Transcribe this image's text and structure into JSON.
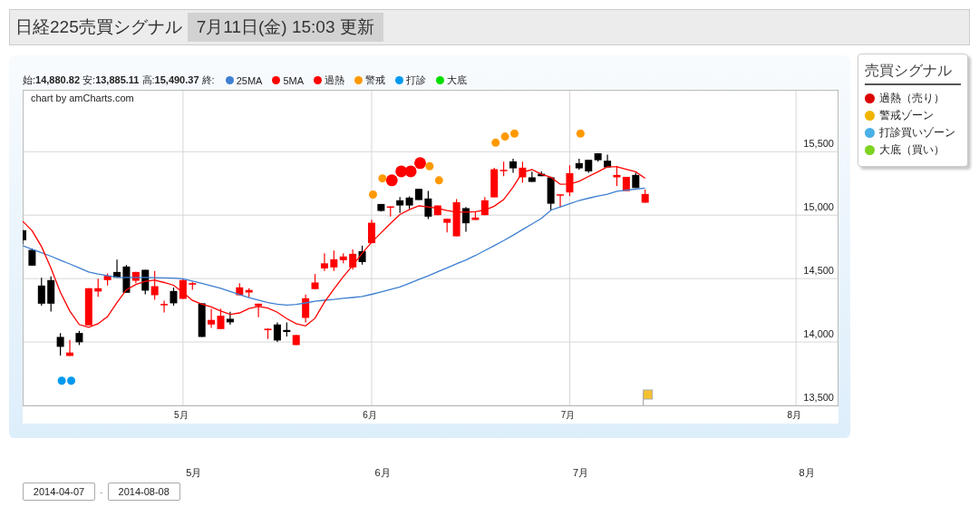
{
  "header": {
    "title": "日経225売買シグナル",
    "updated": "7月11日(金) 15:03 更新"
  },
  "chart": {
    "summary": "始:**14,880.82** 安:**13,885.11** 高:**15,490.37** 終:",
    "credit": "chart by amCharts.com",
    "chart_data": {
      "type": "candlestick",
      "ylim": [
        13500,
        15988
      ],
      "categories": [
        null,
        null,
        null,
        null,
        null,
        null,
        null,
        null,
        null,
        null,
        null,
        null,
        null,
        null,
        null,
        null,
        null,
        "5月",
        null,
        null,
        null,
        null,
        null,
        null,
        null,
        null,
        null,
        null,
        null,
        null,
        null,
        null,
        null,
        null,
        null,
        null,
        null,
        "6月",
        null,
        null,
        null,
        null,
        null,
        null,
        null,
        null,
        null,
        null,
        null,
        null,
        null,
        null,
        null,
        null,
        null,
        null,
        null,
        null,
        "7月",
        null,
        null,
        null,
        null,
        null,
        null,
        null,
        null,
        null,
        null,
        null,
        null,
        null,
        null,
        null,
        null,
        null,
        null,
        null,
        null,
        null,
        null,
        null,
        "8月",
        null,
        null,
        null,
        null
      ],
      "yticks": [
        {
          "value": 13500,
          "label": "13,500"
        },
        {
          "value": 14000,
          "label": "14,000"
        },
        {
          "value": 14500,
          "label": "14,500"
        },
        {
          "value": 15000,
          "label": "15,000"
        },
        {
          "value": 15500,
          "label": "15,500"
        }
      ],
      "series": [
        {
          "name": "25MA",
          "color": "#3d7fd1",
          "type": "line",
          "values": [
            14759,
            14731,
            14704,
            14676,
            14645,
            14615,
            14584,
            14552,
            14535,
            14523,
            14510,
            14509,
            14509,
            14509,
            14507,
            14505,
            14503,
            14499,
            14480,
            14462,
            14443,
            14423,
            14398,
            14373,
            14350,
            14331,
            14311,
            14298,
            14291,
            14296,
            14308,
            14321,
            14329,
            14336,
            14344,
            14351,
            14359,
            14376,
            14395,
            14414,
            14434,
            14462,
            14492,
            14521,
            14553,
            14584,
            14616,
            14647,
            14682,
            14721,
            14760,
            14799,
            14841,
            14886,
            14930,
            14975,
            15039,
            15065,
            15090,
            15116,
            15134,
            15150,
            15165,
            15188,
            15197,
            15205,
            15213,
            null,
            null,
            null,
            null,
            null,
            null,
            null,
            null,
            null,
            null,
            null,
            null,
            null,
            null,
            null,
            null,
            null,
            null,
            null,
            null
          ]
        },
        {
          "name": "5MA",
          "color": "#ff0000",
          "type": "line",
          "values": [
            14952,
            14878,
            14752,
            14584,
            14392,
            14245,
            14138,
            14116,
            14144,
            14201,
            14310,
            14412,
            14454,
            14479,
            14487,
            14469,
            14447,
            14390,
            14328,
            14298,
            14277,
            14245,
            14217,
            14229,
            14264,
            14281,
            14268,
            14235,
            14185,
            14145,
            14127,
            14187,
            14314,
            14417,
            14516,
            14604,
            14700,
            14786,
            14861,
            14935,
            15005,
            15043,
            15073,
            15065,
            15054,
            15036,
            15024,
            15024,
            15028,
            15039,
            15070,
            15122,
            15220,
            15339,
            15359,
            15322,
            15299,
            15243,
            15246,
            15267,
            15305,
            15342,
            15381,
            15381,
            15362,
            15342,
            15291,
            null,
            null,
            null,
            null,
            null,
            null,
            null,
            null,
            null,
            null,
            null,
            null,
            null,
            null,
            null,
            null,
            null,
            null,
            null,
            null
          ]
        },
        {
          "name": "過熱",
          "color": "#ff0000",
          "type": "scatter",
          "values": [
            null,
            null,
            null,
            null,
            null,
            null,
            null,
            null,
            null,
            null,
            null,
            null,
            null,
            null,
            null,
            null,
            null,
            null,
            null,
            null,
            null,
            null,
            null,
            null,
            null,
            null,
            null,
            null,
            null,
            null,
            null,
            null,
            null,
            null,
            null,
            null,
            null,
            null,
            null,
            15274,
            15345,
            15345,
            15410,
            null,
            null,
            null,
            null,
            null,
            null,
            null,
            null,
            null,
            null,
            null,
            null,
            null,
            null,
            null,
            null,
            null,
            null,
            null,
            null,
            null,
            null,
            null,
            null,
            null,
            null,
            null,
            null,
            null,
            null,
            null,
            null,
            null,
            null,
            null,
            null,
            null,
            null,
            null,
            null,
            null,
            null,
            null,
            null
          ]
        },
        {
          "name": "警戒",
          "color": "#ff9900",
          "type": "scatter",
          "values": [
            null,
            null,
            null,
            null,
            null,
            null,
            null,
            null,
            null,
            null,
            null,
            null,
            null,
            null,
            null,
            null,
            null,
            null,
            null,
            null,
            null,
            null,
            null,
            null,
            null,
            null,
            null,
            null,
            null,
            null,
            null,
            null,
            null,
            null,
            null,
            null,
            null,
            15162,
            15290,
            null,
            null,
            null,
            null,
            15386,
            15274,
            null,
            null,
            null,
            null,
            null,
            15571,
            15619,
            15643,
            null,
            null,
            null,
            null,
            null,
            null,
            15643,
            null,
            null,
            null,
            null,
            null,
            null,
            null,
            null,
            null,
            null,
            null,
            null,
            null,
            null,
            null,
            null,
            null,
            null,
            null,
            null,
            null,
            null,
            null,
            null,
            null,
            null,
            null
          ]
        },
        {
          "name": "打診",
          "color": "#0099ee",
          "type": "scatter",
          "values": [
            null,
            null,
            null,
            null,
            13695,
            13695,
            null,
            null,
            null,
            null,
            null,
            null,
            null,
            null,
            null,
            null,
            null,
            null,
            null,
            null,
            null,
            null,
            null,
            null,
            null,
            null,
            null,
            null,
            null,
            null,
            null,
            null,
            null,
            null,
            null,
            null,
            null,
            null,
            null,
            null,
            null,
            null,
            null,
            null,
            null,
            null,
            null,
            null,
            null,
            null,
            null,
            null,
            null,
            null,
            null,
            null,
            null,
            null,
            null,
            null,
            null,
            null,
            null,
            null,
            null,
            null,
            null,
            null,
            null,
            null,
            null,
            null,
            null,
            null,
            null,
            null,
            null,
            null,
            null,
            null,
            null,
            null,
            null,
            null,
            null,
            null,
            null
          ]
        },
        {
          "name": "大底",
          "color": "#00dd00",
          "type": "scatter",
          "values": [
            null,
            null,
            null,
            null,
            null,
            null,
            null,
            null,
            null,
            null,
            null,
            null,
            null,
            null,
            null,
            null,
            null,
            null,
            null,
            null,
            null,
            null,
            null,
            null,
            null,
            null,
            null,
            null,
            null,
            null,
            null,
            null,
            null,
            null,
            null,
            null,
            null,
            null,
            null,
            null,
            null,
            null,
            null,
            null,
            null,
            null,
            null,
            null,
            null,
            null,
            null,
            null,
            null,
            null,
            null,
            null,
            null,
            null,
            null,
            null,
            null,
            null,
            null,
            null,
            null,
            null,
            null,
            null,
            null,
            null,
            null,
            null,
            null,
            null,
            null,
            null,
            null,
            null,
            null,
            null,
            null,
            null,
            null,
            null,
            null,
            null,
            null
          ]
        }
      ],
      "ohlc": [
        [
          14881,
          14881,
          14769,
          14802
        ],
        [
          14726,
          14738,
          14602,
          14602
        ],
        [
          14445,
          14507,
          14286,
          14302
        ],
        [
          14488,
          14517,
          14240,
          14302
        ],
        [
          14040,
          14071,
          13893,
          13962
        ],
        [
          13890,
          14017,
          13890,
          13917
        ],
        [
          14071,
          14088,
          13976,
          13998
        ],
        [
          14131,
          14424,
          14131,
          14424
        ],
        [
          14398,
          14500,
          14357,
          14424
        ],
        [
          14488,
          14540,
          14445,
          14521
        ],
        [
          14552,
          14650,
          14507,
          14507
        ],
        [
          14595,
          14607,
          14388,
          14388
        ],
        [
          14483,
          14552,
          14464,
          14552
        ],
        [
          14569,
          14569,
          14376,
          14405
        ],
        [
          14369,
          14560,
          14333,
          14440
        ],
        [
          14298,
          14326,
          14233,
          14300
        ],
        [
          14402,
          14429,
          14286,
          14305
        ],
        [
          14340,
          14500,
          14340,
          14488
        ],
        [
          14452,
          14474,
          14412,
          14464
        ],
        [
          14305,
          14305,
          14040,
          14040
        ],
        [
          14138,
          14262,
          14112,
          14174
        ],
        [
          14102,
          14262,
          14102,
          14207
        ],
        [
          14183,
          14238,
          14136,
          14155
        ],
        [
          14369,
          14464,
          14369,
          14431
        ],
        [
          14390,
          14424,
          14352,
          14410
        ],
        [
          14283,
          14302,
          14195,
          14302
        ],
        [
          14093,
          14105,
          14024,
          14105
        ],
        [
          14138,
          14155,
          14000,
          14012
        ],
        [
          14095,
          14155,
          14043,
          14079
        ],
        [
          13976,
          14055,
          13976,
          14055
        ],
        [
          14190,
          14374,
          14155,
          14345
        ],
        [
          14417,
          14536,
          14417,
          14469
        ],
        [
          14580,
          14700,
          14560,
          14620
        ],
        [
          14588,
          14720,
          14560,
          14652
        ],
        [
          14645,
          14700,
          14620,
          14674
        ],
        [
          14588,
          14730,
          14570,
          14695
        ],
        [
          14716,
          14760,
          14610,
          14630
        ],
        [
          14779,
          14964,
          14779,
          14940
        ],
        [
          15088,
          15088,
          15029,
          15033
        ],
        [
          15060,
          15069,
          14988,
          15069
        ],
        [
          15117,
          15143,
          15017,
          15076
        ],
        [
          15138,
          15148,
          15048,
          15076
        ],
        [
          15207,
          15207,
          15119,
          15119
        ],
        [
          15131,
          15190,
          14969,
          14988
        ],
        [
          15000,
          15076,
          15000,
          15076
        ],
        [
          14940,
          14971,
          14864,
          14971
        ],
        [
          14833,
          15126,
          14833,
          15102
        ],
        [
          15055,
          15064,
          14869,
          14936
        ],
        [
          14962,
          15024,
          14962,
          14981
        ],
        [
          15000,
          15143,
          15000,
          15117
        ],
        [
          15140,
          15374,
          15140,
          15362
        ],
        [
          15352,
          15421,
          15307,
          15357
        ],
        [
          15424,
          15445,
          15333,
          15369
        ],
        [
          15298,
          15421,
          15255,
          15374
        ],
        [
          15298,
          15343,
          15262,
          15262
        ],
        [
          15326,
          15345,
          15307,
          15307
        ],
        [
          15298,
          15298,
          15036,
          15090
        ],
        [
          15155,
          15164,
          15060,
          15164
        ],
        [
          15179,
          15393,
          15150,
          15331
        ],
        [
          15410,
          15445,
          15357,
          15369
        ],
        [
          15436,
          15436,
          15333,
          15345
        ],
        [
          15488,
          15488,
          15421,
          15433
        ],
        [
          15429,
          15476,
          15376,
          15376
        ],
        [
          15298,
          15388,
          15229,
          15317
        ],
        [
          15190,
          15302,
          15190,
          15302
        ],
        [
          15317,
          15333,
          15214,
          15214
        ],
        [
          15098,
          15202,
          15098,
          15167
        ],
        null,
        null,
        null,
        null,
        null,
        null,
        null,
        null,
        null,
        null,
        null,
        null,
        null,
        null,
        null,
        null,
        null,
        null,
        null,
        null
      ],
      "grid": true,
      "legend": "top"
    }
  },
  "signal_legend": {
    "title": "売買シグナル",
    "items": [
      {
        "label": "過熱（売り）",
        "color": "#dd0000"
      },
      {
        "label": "警戒ゾーン",
        "color": "#f0b400"
      },
      {
        "label": "打診買いゾーン",
        "color": "#4ab0e8"
      },
      {
        "label": "大底（買い）",
        "color": "#7ed321"
      }
    ]
  },
  "navigator": {
    "months": [
      "5月",
      "6月",
      "7月",
      "8月"
    ]
  },
  "range": {
    "from": "2014-04-07",
    "separator": "-",
    "to": "2014-08-08"
  }
}
